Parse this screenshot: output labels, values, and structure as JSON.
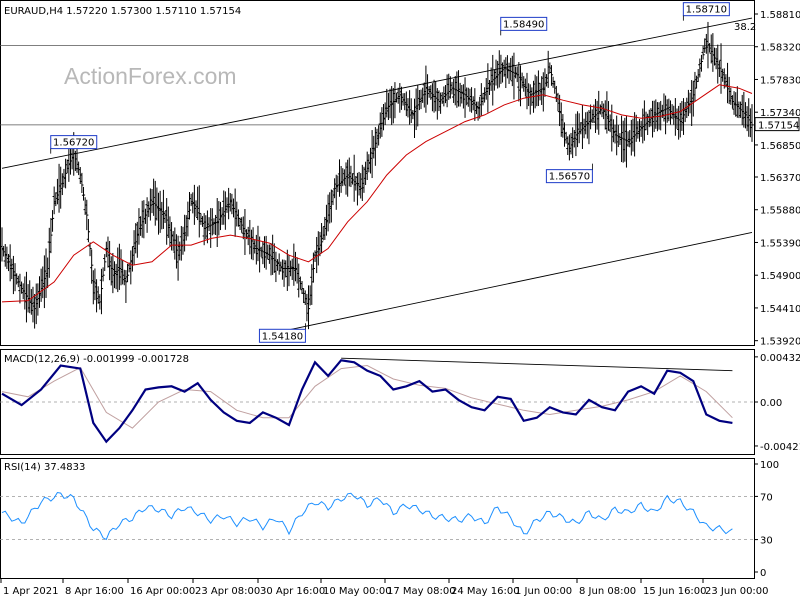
{
  "colors": {
    "background": "#ffffff",
    "grid": "#c8c8c8",
    "candle": "#000000",
    "ma": "#cc0000",
    "macd": "#000080",
    "signal": "#c0a0a0",
    "rsi": "#1e90ff",
    "label_box": "#1e3cc8"
  },
  "chart_data": [
    {
      "type": "line",
      "title": "EURAUD,H4 1.57220 1.57300 1.57110 1.57154",
      "watermark": "ActionForex.com",
      "ylim": [
        1.539,
        1.5881
      ],
      "y_ticks": [
        "1.58810",
        "1.58320",
        "1.57830",
        "1.57340",
        "1.56850",
        "1.56370",
        "1.55880",
        "1.55390",
        "1.54900",
        "1.54410",
        "1.53920"
      ],
      "x_ticks": [
        "1 Apr 2021",
        "8 Apr 16:00",
        "16 Apr 00:00",
        "23 Apr 08:00",
        "30 Apr 16:00",
        "10 May 00:00",
        "17 May 08:00",
        "24 May 16:00",
        "1 Jun 00:00",
        "8 Jun 08:00",
        "15 Jun 16:00",
        "23 Jun 00:00"
      ],
      "current_price": "1.57154",
      "fib_label": "38.2",
      "annotations": [
        {
          "text": "1.56720",
          "value": 1.5672
        },
        {
          "text": "1.54180",
          "value": 1.5418
        },
        {
          "text": "1.58490",
          "value": 1.5849
        },
        {
          "text": "1.56570",
          "value": 1.5657
        },
        {
          "text": "1.58710",
          "value": 1.5871
        }
      ],
      "price_series": [
        {
          "x": 0,
          "y": 1.553
        },
        {
          "x": 3,
          "y": 1.547
        },
        {
          "x": 5,
          "y": 1.544
        },
        {
          "x": 7,
          "y": 1.55
        },
        {
          "x": 8,
          "y": 1.56
        },
        {
          "x": 9,
          "y": 1.562
        },
        {
          "x": 10,
          "y": 1.565
        },
        {
          "x": 11,
          "y": 1.5672
        },
        {
          "x": 12,
          "y": 1.564
        },
        {
          "x": 13,
          "y": 1.558
        },
        {
          "x": 14,
          "y": 1.548
        },
        {
          "x": 15,
          "y": 1.545
        },
        {
          "x": 16,
          "y": 1.553
        },
        {
          "x": 17,
          "y": 1.549
        },
        {
          "x": 18,
          "y": 1.55
        },
        {
          "x": 19,
          "y": 1.548
        },
        {
          "x": 21,
          "y": 1.556
        },
        {
          "x": 23,
          "y": 1.56
        },
        {
          "x": 25,
          "y": 1.558
        },
        {
          "x": 27,
          "y": 1.552
        },
        {
          "x": 28,
          "y": 1.555
        },
        {
          "x": 29,
          "y": 1.56
        },
        {
          "x": 30,
          "y": 1.559
        },
        {
          "x": 31,
          "y": 1.556
        },
        {
          "x": 33,
          "y": 1.557
        },
        {
          "x": 35,
          "y": 1.56
        },
        {
          "x": 37,
          "y": 1.556
        },
        {
          "x": 39,
          "y": 1.553
        },
        {
          "x": 41,
          "y": 1.552
        },
        {
          "x": 43,
          "y": 1.55
        },
        {
          "x": 45,
          "y": 1.55
        },
        {
          "x": 46,
          "y": 1.547
        },
        {
          "x": 47,
          "y": 1.544
        },
        {
          "x": 48,
          "y": 1.552
        },
        {
          "x": 49,
          "y": 1.554
        },
        {
          "x": 50,
          "y": 1.558
        },
        {
          "x": 51,
          "y": 1.562
        },
        {
          "x": 53,
          "y": 1.564
        },
        {
          "x": 55,
          "y": 1.562
        },
        {
          "x": 57,
          "y": 1.568
        },
        {
          "x": 59,
          "y": 1.574
        },
        {
          "x": 61,
          "y": 1.576
        },
        {
          "x": 63,
          "y": 1.573
        },
        {
          "x": 65,
          "y": 1.577
        },
        {
          "x": 67,
          "y": 1.575
        },
        {
          "x": 69,
          "y": 1.577
        },
        {
          "x": 71,
          "y": 1.576
        },
        {
          "x": 73,
          "y": 1.574
        },
        {
          "x": 75,
          "y": 1.578
        },
        {
          "x": 77,
          "y": 1.58
        },
        {
          "x": 79,
          "y": 1.579
        },
        {
          "x": 81,
          "y": 1.576
        },
        {
          "x": 83,
          "y": 1.577
        },
        {
          "x": 84,
          "y": 1.58
        },
        {
          "x": 85,
          "y": 1.576
        },
        {
          "x": 86,
          "y": 1.571
        },
        {
          "x": 87,
          "y": 1.568
        },
        {
          "x": 88,
          "y": 1.57
        },
        {
          "x": 90,
          "y": 1.572
        },
        {
          "x": 92,
          "y": 1.574
        },
        {
          "x": 94,
          "y": 1.57
        },
        {
          "x": 96,
          "y": 1.569
        },
        {
          "x": 98,
          "y": 1.571
        },
        {
          "x": 100,
          "y": 1.573
        },
        {
          "x": 102,
          "y": 1.574
        },
        {
          "x": 104,
          "y": 1.572
        },
        {
          "x": 106,
          "y": 1.576
        },
        {
          "x": 107,
          "y": 1.58
        },
        {
          "x": 108,
          "y": 1.584
        },
        {
          "x": 109,
          "y": 1.582
        },
        {
          "x": 110,
          "y": 1.58
        },
        {
          "x": 111,
          "y": 1.578
        },
        {
          "x": 112,
          "y": 1.575
        },
        {
          "x": 113,
          "y": 1.574
        },
        {
          "x": 114,
          "y": 1.573
        },
        {
          "x": 115,
          "y": 1.5715
        }
      ],
      "ma_series": [
        {
          "x": 0,
          "y": 1.545
        },
        {
          "x": 4,
          "y": 1.5452
        },
        {
          "x": 8,
          "y": 1.548
        },
        {
          "x": 11,
          "y": 1.552
        },
        {
          "x": 14,
          "y": 1.554
        },
        {
          "x": 17,
          "y": 1.552
        },
        {
          "x": 20,
          "y": 1.5505
        },
        {
          "x": 23,
          "y": 1.551
        },
        {
          "x": 26,
          "y": 1.5535
        },
        {
          "x": 29,
          "y": 1.5535
        },
        {
          "x": 32,
          "y": 1.5545
        },
        {
          "x": 35,
          "y": 1.555
        },
        {
          "x": 38,
          "y": 1.5545
        },
        {
          "x": 41,
          "y": 1.5538
        },
        {
          "x": 44,
          "y": 1.552
        },
        {
          "x": 47,
          "y": 1.551
        },
        {
          "x": 50,
          "y": 1.553
        },
        {
          "x": 53,
          "y": 1.557
        },
        {
          "x": 56,
          "y": 1.56
        },
        {
          "x": 59,
          "y": 1.564
        },
        {
          "x": 62,
          "y": 1.567
        },
        {
          "x": 65,
          "y": 1.569
        },
        {
          "x": 68,
          "y": 1.5705
        },
        {
          "x": 71,
          "y": 1.572
        },
        {
          "x": 74,
          "y": 1.573
        },
        {
          "x": 77,
          "y": 1.5745
        },
        {
          "x": 80,
          "y": 1.5755
        },
        {
          "x": 83,
          "y": 1.576
        },
        {
          "x": 86,
          "y": 1.5752
        },
        {
          "x": 89,
          "y": 1.5745
        },
        {
          "x": 92,
          "y": 1.574
        },
        {
          "x": 95,
          "y": 1.573
        },
        {
          "x": 98,
          "y": 1.5725
        },
        {
          "x": 101,
          "y": 1.5728
        },
        {
          "x": 104,
          "y": 1.5735
        },
        {
          "x": 107,
          "y": 1.5755
        },
        {
          "x": 110,
          "y": 1.5775
        },
        {
          "x": 113,
          "y": 1.577
        },
        {
          "x": 115,
          "y": 1.5762
        }
      ],
      "channel_lines": [
        {
          "x1": 0,
          "y1": 1.565,
          "x2": 115,
          "y2": 1.5875
        },
        {
          "x1": 40,
          "y1": 1.54,
          "x2": 115,
          "y2": 1.5554
        }
      ],
      "horizontal_lines": [
        1.5834,
        1.5715
      ]
    },
    {
      "type": "line",
      "title": "MACD(12,26,9) -0.001999 -0.001728",
      "ylim": [
        -0.0046,
        0.0046
      ],
      "y_ticks": [
        "0.004325",
        "0.00",
        "-0.004213"
      ],
      "macd_series": [
        {
          "x": 0,
          "y": 0.0008
        },
        {
          "x": 3,
          "y": -0.0003
        },
        {
          "x": 6,
          "y": 0.0012
        },
        {
          "x": 9,
          "y": 0.0035
        },
        {
          "x": 12,
          "y": 0.0032
        },
        {
          "x": 14,
          "y": -0.002
        },
        {
          "x": 16,
          "y": -0.0038
        },
        {
          "x": 18,
          "y": -0.0025
        },
        {
          "x": 20,
          "y": -0.0008
        },
        {
          "x": 22,
          "y": 0.0012
        },
        {
          "x": 24,
          "y": 0.0014
        },
        {
          "x": 26,
          "y": 0.0015
        },
        {
          "x": 28,
          "y": 0.001
        },
        {
          "x": 30,
          "y": 0.0018
        },
        {
          "x": 32,
          "y": 0.0002
        },
        {
          "x": 34,
          "y": -0.001
        },
        {
          "x": 36,
          "y": -0.0018
        },
        {
          "x": 38,
          "y": -0.002
        },
        {
          "x": 40,
          "y": -0.001
        },
        {
          "x": 42,
          "y": -0.0015
        },
        {
          "x": 44,
          "y": -0.0022
        },
        {
          "x": 46,
          "y": 0.0012
        },
        {
          "x": 48,
          "y": 0.0038
        },
        {
          "x": 50,
          "y": 0.0025
        },
        {
          "x": 52,
          "y": 0.004
        },
        {
          "x": 54,
          "y": 0.0038
        },
        {
          "x": 56,
          "y": 0.003
        },
        {
          "x": 58,
          "y": 0.0025
        },
        {
          "x": 60,
          "y": 0.0012
        },
        {
          "x": 62,
          "y": 0.0015
        },
        {
          "x": 64,
          "y": 0.002
        },
        {
          "x": 66,
          "y": 0.001
        },
        {
          "x": 68,
          "y": 0.0012
        },
        {
          "x": 70,
          "y": 0.0002
        },
        {
          "x": 72,
          "y": -0.0005
        },
        {
          "x": 74,
          "y": -0.0008
        },
        {
          "x": 76,
          "y": 0.0005
        },
        {
          "x": 78,
          "y": 0.0003
        },
        {
          "x": 80,
          "y": -0.0018
        },
        {
          "x": 82,
          "y": -0.0015
        },
        {
          "x": 84,
          "y": -0.0005
        },
        {
          "x": 86,
          "y": -0.001
        },
        {
          "x": 88,
          "y": -0.0012
        },
        {
          "x": 90,
          "y": 0.0002
        },
        {
          "x": 92,
          "y": -0.0005
        },
        {
          "x": 94,
          "y": -0.0008
        },
        {
          "x": 96,
          "y": 0.001
        },
        {
          "x": 98,
          "y": 0.0015
        },
        {
          "x": 100,
          "y": 0.0008
        },
        {
          "x": 102,
          "y": 0.003
        },
        {
          "x": 104,
          "y": 0.0028
        },
        {
          "x": 106,
          "y": 0.002
        },
        {
          "x": 108,
          "y": -0.0012
        },
        {
          "x": 110,
          "y": -0.0018
        },
        {
          "x": 112,
          "y": -0.002
        }
      ],
      "signal_series": [
        {
          "x": 0,
          "y": 0.001
        },
        {
          "x": 4,
          "y": 0.0005
        },
        {
          "x": 8,
          "y": 0.002
        },
        {
          "x": 12,
          "y": 0.0033
        },
        {
          "x": 16,
          "y": -0.001
        },
        {
          "x": 20,
          "y": -0.0025
        },
        {
          "x": 24,
          "y": 0.0
        },
        {
          "x": 28,
          "y": 0.0012
        },
        {
          "x": 32,
          "y": 0.001
        },
        {
          "x": 36,
          "y": -0.0008
        },
        {
          "x": 40,
          "y": -0.0015
        },
        {
          "x": 44,
          "y": -0.0015
        },
        {
          "x": 48,
          "y": 0.0015
        },
        {
          "x": 52,
          "y": 0.0032
        },
        {
          "x": 56,
          "y": 0.0035
        },
        {
          "x": 60,
          "y": 0.0022
        },
        {
          "x": 64,
          "y": 0.0016
        },
        {
          "x": 68,
          "y": 0.0013
        },
        {
          "x": 72,
          "y": 0.0004
        },
        {
          "x": 76,
          "y": -0.0002
        },
        {
          "x": 80,
          "y": -0.0008
        },
        {
          "x": 84,
          "y": -0.0012
        },
        {
          "x": 88,
          "y": -0.0008
        },
        {
          "x": 92,
          "y": -0.0004
        },
        {
          "x": 96,
          "y": 0.0002
        },
        {
          "x": 100,
          "y": 0.001
        },
        {
          "x": 104,
          "y": 0.0025
        },
        {
          "x": 108,
          "y": 0.001
        },
        {
          "x": 112,
          "y": -0.0015
        }
      ],
      "trend_line": {
        "x1": 52,
        "y1": 0.0042,
        "x2": 112,
        "y2": 0.003
      }
    },
    {
      "type": "line",
      "title": "RSI(14) 37.4833",
      "ylim": [
        0,
        100
      ],
      "y_ticks": [
        "100",
        "70",
        "30",
        "0"
      ],
      "levels": [
        70,
        30
      ],
      "rsi_series": [
        {
          "x": 0,
          "y": 55
        },
        {
          "x": 3,
          "y": 45
        },
        {
          "x": 6,
          "y": 65
        },
        {
          "x": 9,
          "y": 72
        },
        {
          "x": 11,
          "y": 68
        },
        {
          "x": 14,
          "y": 40
        },
        {
          "x": 16,
          "y": 32
        },
        {
          "x": 18,
          "y": 45
        },
        {
          "x": 20,
          "y": 50
        },
        {
          "x": 22,
          "y": 60
        },
        {
          "x": 24,
          "y": 58
        },
        {
          "x": 26,
          "y": 52
        },
        {
          "x": 28,
          "y": 60
        },
        {
          "x": 30,
          "y": 55
        },
        {
          "x": 32,
          "y": 48
        },
        {
          "x": 34,
          "y": 52
        },
        {
          "x": 36,
          "y": 45
        },
        {
          "x": 38,
          "y": 50
        },
        {
          "x": 40,
          "y": 42
        },
        {
          "x": 42,
          "y": 50
        },
        {
          "x": 44,
          "y": 38
        },
        {
          "x": 46,
          "y": 55
        },
        {
          "x": 48,
          "y": 65
        },
        {
          "x": 50,
          "y": 60
        },
        {
          "x": 52,
          "y": 68
        },
        {
          "x": 54,
          "y": 72
        },
        {
          "x": 56,
          "y": 62
        },
        {
          "x": 58,
          "y": 68
        },
        {
          "x": 60,
          "y": 55
        },
        {
          "x": 62,
          "y": 62
        },
        {
          "x": 64,
          "y": 58
        },
        {
          "x": 66,
          "y": 52
        },
        {
          "x": 68,
          "y": 50
        },
        {
          "x": 70,
          "y": 48
        },
        {
          "x": 72,
          "y": 52
        },
        {
          "x": 74,
          "y": 45
        },
        {
          "x": 76,
          "y": 60
        },
        {
          "x": 78,
          "y": 50
        },
        {
          "x": 80,
          "y": 35
        },
        {
          "x": 82,
          "y": 48
        },
        {
          "x": 84,
          "y": 55
        },
        {
          "x": 86,
          "y": 50
        },
        {
          "x": 88,
          "y": 45
        },
        {
          "x": 90,
          "y": 55
        },
        {
          "x": 92,
          "y": 48
        },
        {
          "x": 94,
          "y": 58
        },
        {
          "x": 96,
          "y": 55
        },
        {
          "x": 98,
          "y": 62
        },
        {
          "x": 100,
          "y": 55
        },
        {
          "x": 102,
          "y": 68
        },
        {
          "x": 104,
          "y": 65
        },
        {
          "x": 106,
          "y": 55
        },
        {
          "x": 108,
          "y": 42
        },
        {
          "x": 110,
          "y": 40
        },
        {
          "x": 112,
          "y": 37
        }
      ]
    }
  ]
}
